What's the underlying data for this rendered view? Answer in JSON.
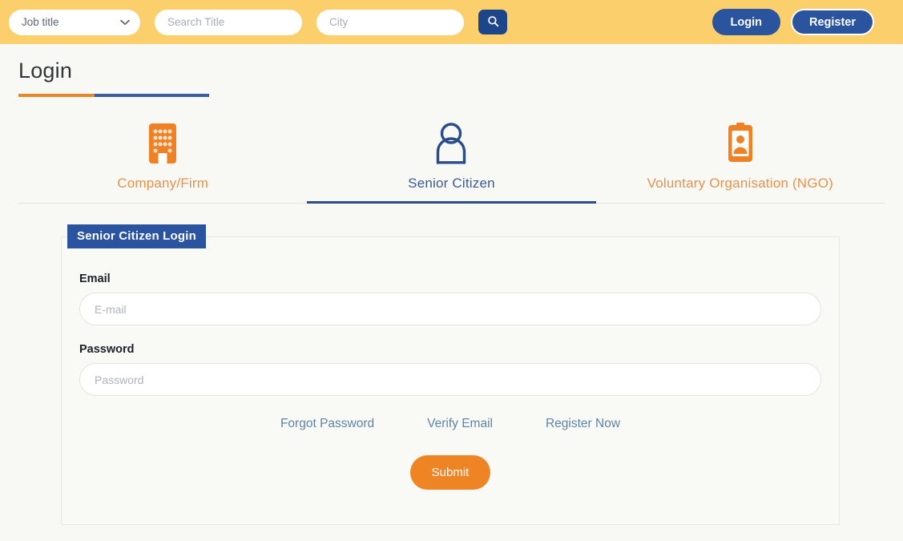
{
  "topbar": {
    "job_select": {
      "value": "Job title",
      "options": [
        "Job title"
      ]
    },
    "search_title": {
      "placeholder": "Search Title",
      "value": ""
    },
    "city": {
      "placeholder": "City",
      "value": ""
    },
    "search_icon": "search-icon",
    "chevron_icon": "chevron-down-icon",
    "login_label": "Login",
    "register_label": "Register",
    "bg_color": "#fccf6d",
    "accent_blue": "#2b549f"
  },
  "page": {
    "title": "Login",
    "rule_orange": "#e8862a",
    "rule_blue": "#3b5ca0"
  },
  "tabs": [
    {
      "label": "Company/Firm",
      "icon": "building-icon",
      "active": false
    },
    {
      "label": "Senior Citizen",
      "icon": "person-icon",
      "active": true
    },
    {
      "label": "Voluntary Organisation (NGO)",
      "icon": "id-badge-icon",
      "active": false
    }
  ],
  "form": {
    "badge": "Senior Citizen Login",
    "email": {
      "label": "Email",
      "placeholder": "E-mail",
      "value": ""
    },
    "password": {
      "label": "Password",
      "placeholder": "Password",
      "value": ""
    },
    "links": [
      {
        "label": "Forgot Password"
      },
      {
        "label": "Verify Email"
      },
      {
        "label": "Register Now"
      }
    ],
    "submit_label": "Submit",
    "submit_color": "#ef8424"
  }
}
